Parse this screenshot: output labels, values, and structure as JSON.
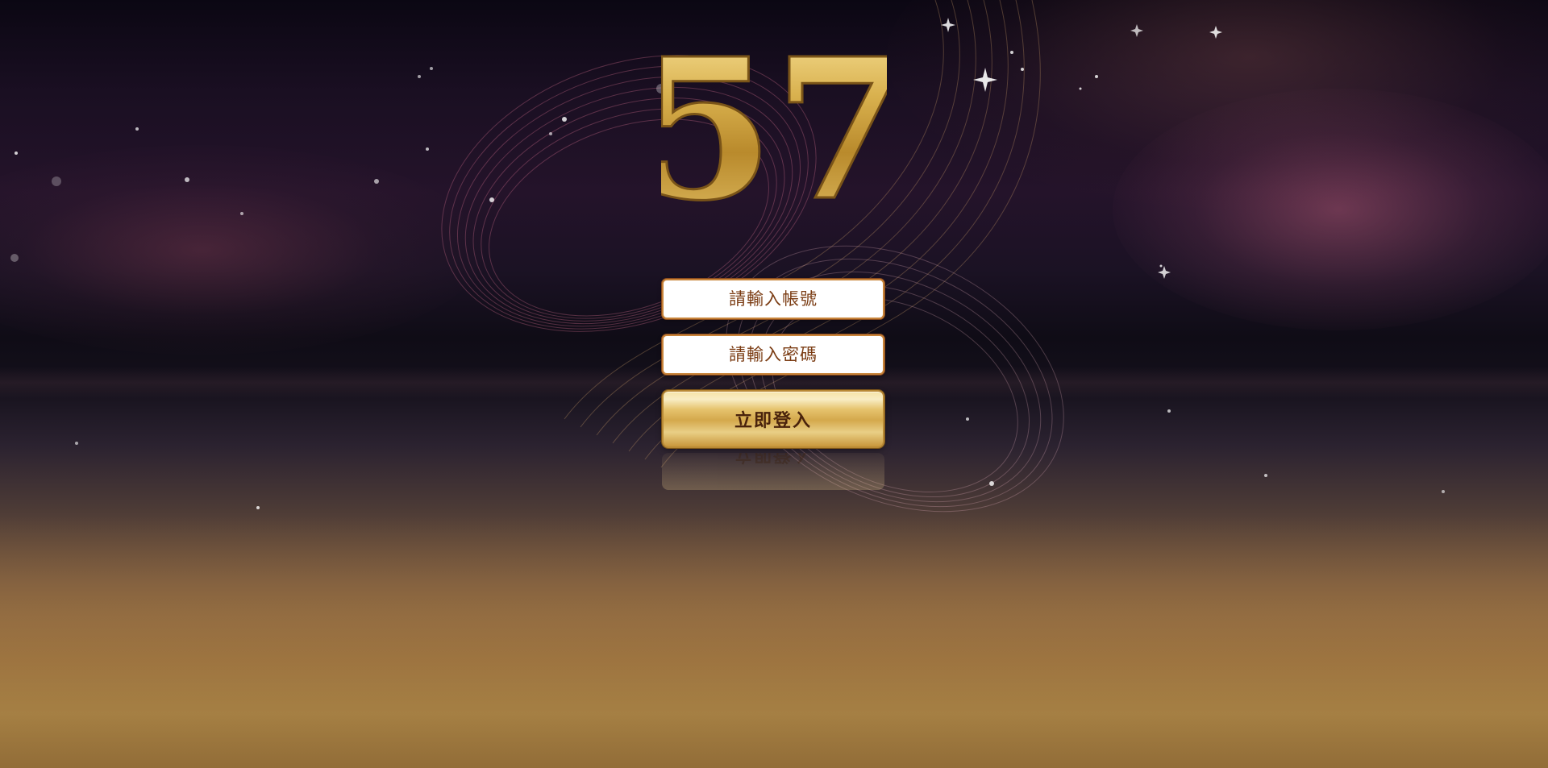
{
  "logo": {
    "text": "57",
    "color": "#d9b14e"
  },
  "login_form": {
    "account_placeholder": "請輸入帳號",
    "password_placeholder": "請輸入密碼",
    "submit_label": "立即登入"
  },
  "colors": {
    "field_border": "#c8843a",
    "field_text": "#7a3b12",
    "button_gold": "#e6c46e",
    "button_text": "#4a230c"
  }
}
